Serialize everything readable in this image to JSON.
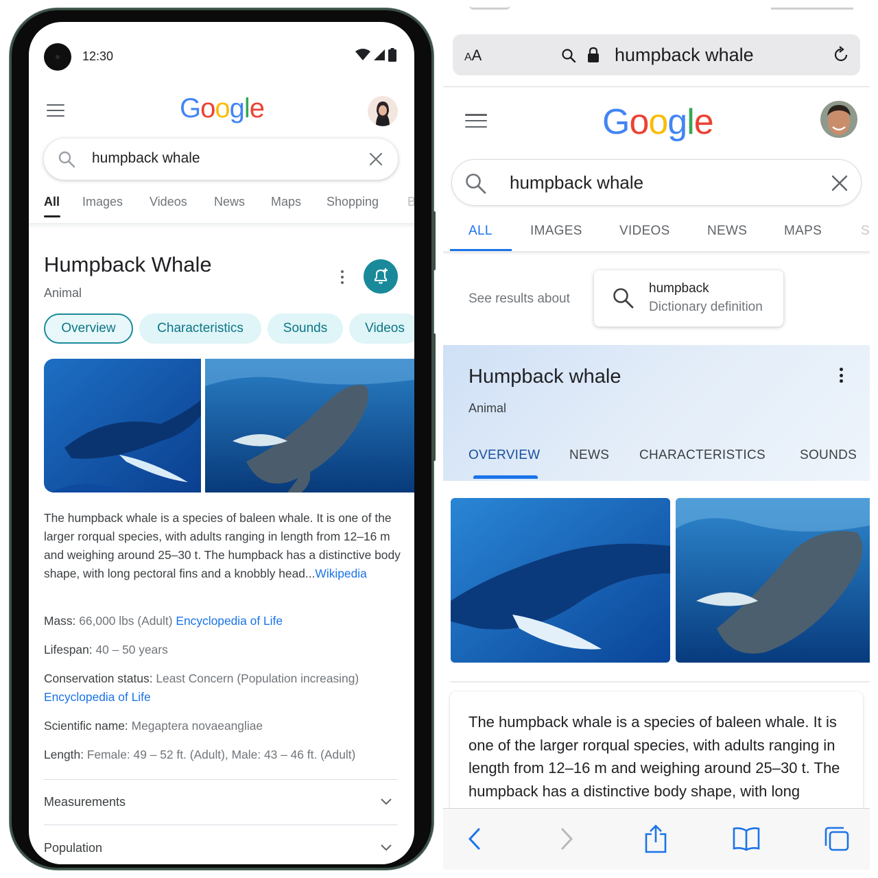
{
  "android": {
    "status_time": "12:30",
    "search_query": "humpback whale",
    "tabs": [
      {
        "label": "All",
        "active": true
      },
      {
        "label": "Images"
      },
      {
        "label": "Videos"
      },
      {
        "label": "News"
      },
      {
        "label": "Maps"
      },
      {
        "label": "Shopping"
      },
      {
        "label": "B"
      }
    ],
    "knowledge_panel": {
      "title": "Humpback Whale",
      "subtitle": "Animal",
      "chips": [
        {
          "label": "Overview",
          "active": true
        },
        {
          "label": "Characteristics"
        },
        {
          "label": "Sounds"
        },
        {
          "label": "Videos"
        }
      ],
      "description": "The humpback whale is a species of baleen whale. It is one of the larger rorqual species, with adults ranging in length from 12–16 m and weighing around 25–30 t. The humpback has a distinctive body shape, with long pectoral fins and a knobbly head...",
      "description_link": "Wikipedia",
      "facts": [
        {
          "key": "Mass:",
          "value": "66,000 lbs (Adult)",
          "link": "Encyclopedia of Life"
        },
        {
          "key": "Lifespan:",
          "value": "40 – 50 years",
          "link": ""
        },
        {
          "key": "Conservation status:",
          "value": "Least Concern (Population increasing)",
          "link": "Encyclopedia of Life"
        },
        {
          "key": "Scientific name:",
          "value": "Megaptera novaeangliae",
          "link": ""
        },
        {
          "key": "Length:",
          "value": "Female: 49 – 52 ft. (Adult), Male: 43 – 46 ft. (Adult)",
          "link": ""
        }
      ],
      "accordions": [
        {
          "label": "Measurements"
        },
        {
          "label": "Population"
        }
      ]
    }
  },
  "ios": {
    "url_aa_small": "A",
    "url_aa_large": "A",
    "url_text": "humpback whale",
    "search_query": "humpback whale",
    "tabs": [
      {
        "label": "ALL",
        "active": true
      },
      {
        "label": "IMAGES"
      },
      {
        "label": "VIDEOS"
      },
      {
        "label": "NEWS"
      },
      {
        "label": "MAPS"
      },
      {
        "label": "S"
      }
    ],
    "see_results_label": "See results about",
    "about_card": {
      "title": "humpback",
      "subtitle": "Dictionary definition"
    },
    "knowledge_panel": {
      "title": "Humpback whale",
      "subtitle": "Animal",
      "tabs": [
        {
          "label": "OVERVIEW",
          "active": true
        },
        {
          "label": "NEWS"
        },
        {
          "label": "CHARACTERISTICS"
        },
        {
          "label": "SOUNDS"
        }
      ]
    },
    "description": "The humpback whale is a species of baleen whale. It is one of the larger rorqual species, with adults ranging in length from 12–16 m and weighing around 25–30 t. The humpback has a distinctive body shape, with long pectoral fins and a knobbly head"
  },
  "icons": [
    "menu-icon",
    "search-icon",
    "close-icon",
    "more-vert-icon",
    "add-alert-icon",
    "lock-icon",
    "reload-icon",
    "back-icon",
    "forward-icon",
    "share-icon",
    "bookmarks-icon",
    "tabs-icon",
    "wifi-icon",
    "signal-icon",
    "battery-icon",
    "chevron-down-icon"
  ],
  "colors": {
    "google_blue": "#4285f4",
    "google_red": "#ea4335",
    "google_yellow": "#fbbc05",
    "google_green": "#34a853",
    "link": "#1a73e8",
    "chip_teal": "#1a8a9b"
  }
}
